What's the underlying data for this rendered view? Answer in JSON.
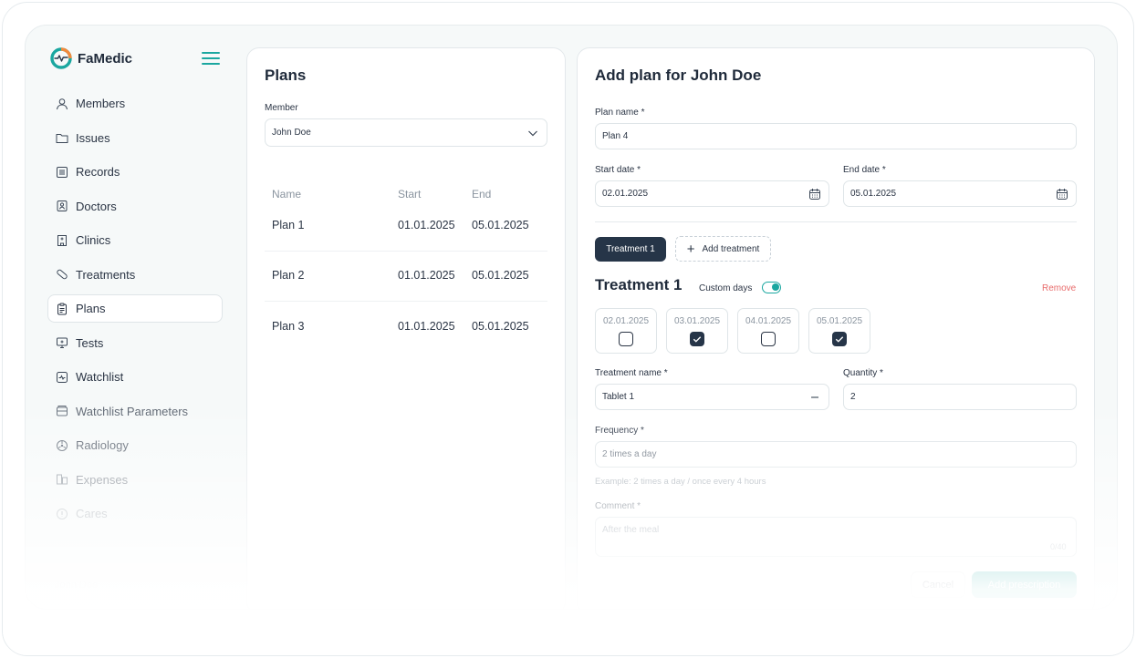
{
  "app": {
    "name": "FaMedic"
  },
  "sidebar": {
    "items": [
      {
        "label": "Members",
        "icon": "user-icon"
      },
      {
        "label": "Issues",
        "icon": "folder-icon"
      },
      {
        "label": "Records",
        "icon": "records-icon"
      },
      {
        "label": "Doctors",
        "icon": "doctor-icon"
      },
      {
        "label": "Clinics",
        "icon": "clinic-icon"
      },
      {
        "label": "Treatments",
        "icon": "pill-icon"
      },
      {
        "label": "Plans",
        "icon": "clipboard-icon",
        "active": true
      },
      {
        "label": "Tests",
        "icon": "test-icon"
      },
      {
        "label": "Watchlist",
        "icon": "watchlist-icon"
      },
      {
        "label": "Watchlist Parameters",
        "icon": "parameters-icon"
      },
      {
        "label": "Radiology",
        "icon": "radiology-icon"
      },
      {
        "label": "Expenses",
        "icon": "expenses-icon"
      },
      {
        "label": "Cares",
        "icon": "cares-icon"
      }
    ],
    "user_name": "John Doe"
  },
  "plans_panel": {
    "title": "Plans",
    "member_label": "Member",
    "member_value": "John Doe",
    "columns": [
      "Name",
      "Start",
      "End"
    ],
    "rows": [
      {
        "name": "Plan 1",
        "start": "01.01.2025",
        "end": "05.01.2025"
      },
      {
        "name": "Plan 2",
        "start": "01.01.2025",
        "end": "05.01.2025"
      },
      {
        "name": "Plan 3",
        "start": "01.01.2025",
        "end": "05.01.2025"
      }
    ]
  },
  "add_panel": {
    "title": "Add plan for John Doe",
    "plan_name_label": "Plan name *",
    "plan_name_value": "Plan 4",
    "start_label": "Start date *",
    "start_value": "02.01.2025",
    "end_label": "End date *",
    "end_value": "05.01.2025",
    "tab_treatment": "Treatment 1",
    "add_treatment": "Add treatment",
    "treatment_title": "Treatment 1",
    "custom_days_label": "Custom days",
    "custom_days_on": true,
    "remove_label": "Remove",
    "days": [
      {
        "date": "02.01.2025",
        "checked": false
      },
      {
        "date": "03.01.2025",
        "checked": true
      },
      {
        "date": "04.01.2025",
        "checked": false
      },
      {
        "date": "05.01.2025",
        "checked": true
      }
    ],
    "treatment_name_label": "Treatment name *",
    "treatment_name_value": "Tablet 1",
    "quantity_label": "Quantity *",
    "quantity_value": "2",
    "frequency_label": "Frequency *",
    "frequency_value": "2 times a day",
    "frequency_hint": "Example: 2 times a day / once every 4 hours",
    "comment_label": "Comment *",
    "comment_placeholder": "After the meal",
    "comment_counter": "0/40",
    "cancel_label": "Cancel",
    "submit_label": "Add prescription"
  },
  "colors": {
    "accent": "#1aa7a0",
    "dark": "#263548",
    "danger": "#e86b6b"
  }
}
